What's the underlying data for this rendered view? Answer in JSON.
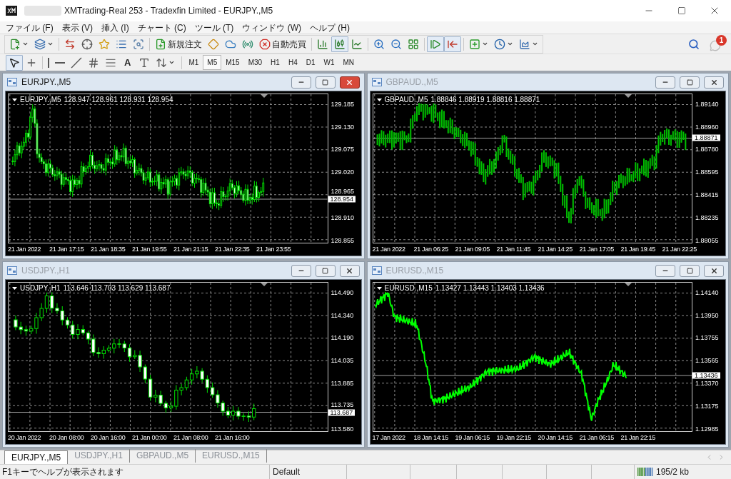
{
  "window": {
    "title": "XMTrading-Real 253 - Tradexfin Limited - EURJPY.,M5"
  },
  "menu": [
    "ファイル (F)",
    "表示 (V)",
    "挿入 (I)",
    "チャート (C)",
    "ツール (T)",
    "ウィンドウ (W)",
    "ヘルプ (H)"
  ],
  "toolbar": [
    {
      "kind": "button",
      "dropdown": true,
      "pressed": false
    },
    {
      "kind": "button",
      "dropdown": true,
      "pressed": false
    },
    {
      "kind": "separator"
    },
    {
      "kind": "button",
      "pressed": false
    },
    {
      "kind": "button",
      "pressed": false
    },
    {
      "kind": "button",
      "pressed": false
    },
    {
      "kind": "button",
      "pressed": false
    },
    {
      "kind": "button",
      "pressed": false
    },
    {
      "kind": "separator"
    },
    {
      "kind": "button",
      "label": "新規注文",
      "pressed": false
    },
    {
      "kind": "button",
      "pressed": false
    },
    {
      "kind": "button",
      "pressed": false
    },
    {
      "kind": "button",
      "pressed": false
    },
    {
      "kind": "button",
      "label": "自動売買",
      "pressed": false
    },
    {
      "kind": "separator"
    },
    {
      "kind": "button",
      "pressed": false
    },
    {
      "kind": "button",
      "pressed": true
    },
    {
      "kind": "button",
      "pressed": false
    },
    {
      "kind": "separator"
    },
    {
      "kind": "button",
      "pressed": false
    },
    {
      "kind": "button",
      "pressed": false
    },
    {
      "kind": "button",
      "pressed": false
    },
    {
      "kind": "separator"
    },
    {
      "kind": "button",
      "pressed": true
    },
    {
      "kind": "button",
      "pressed": true
    },
    {
      "kind": "separator"
    },
    {
      "kind": "button",
      "dropdown": true,
      "pressed": false
    },
    {
      "kind": "button",
      "dropdown": true,
      "pressed": false
    },
    {
      "kind": "button",
      "dropdown": true,
      "pressed": false
    }
  ],
  "notifications": {
    "badge": "1"
  },
  "drawing_tools": [
    {
      "kind": "button",
      "pressed": true
    },
    {
      "kind": "button",
      "pressed": false
    },
    {
      "kind": "separator"
    },
    {
      "kind": "button",
      "pressed": false
    },
    {
      "kind": "button",
      "pressed": false
    },
    {
      "kind": "button",
      "pressed": false
    },
    {
      "kind": "button",
      "pressed": false
    },
    {
      "kind": "button",
      "pressed": false
    },
    {
      "kind": "button",
      "label": "A",
      "pressed": false
    },
    {
      "kind": "button",
      "pressed": false
    },
    {
      "kind": "button",
      "dropdown": true,
      "pressed": false
    }
  ],
  "timeframes": [
    {
      "label": "M1",
      "selected": false
    },
    {
      "label": "M5",
      "selected": true
    },
    {
      "label": "M15",
      "selected": false
    },
    {
      "label": "M30",
      "selected": false
    },
    {
      "label": "H1",
      "selected": false
    },
    {
      "label": "H4",
      "selected": false
    },
    {
      "label": "D1",
      "selected": false
    },
    {
      "label": "W1",
      "selected": false
    },
    {
      "label": "MN",
      "selected": false
    }
  ],
  "charts": [
    {
      "title": "EURJPY.,M5",
      "active": true,
      "kind": "candles",
      "symbol": "EURJPY.,M5",
      "ohlc": "128.947 128.961 128.931 128.954",
      "price": "128.954",
      "price_ticks": [
        "129.185",
        "129.130",
        "129.075",
        "129.020",
        "128.965",
        "128.910",
        "128.855"
      ],
      "time_ticks": [
        "21 Jan 2022",
        "21 Jan 17:15",
        "21 Jan 18:35",
        "21 Jan 19:55",
        "21 Jan 21:15",
        "21 Jan 22:35",
        "21 Jan 23:55"
      ]
    },
    {
      "title": "GBPAUD.,M5",
      "active": false,
      "kind": "bars",
      "symbol": "GBPAUD.,M5",
      "ohlc": "1.88846 1.88919 1.88816 1.88871",
      "price": "1.88871",
      "price_ticks": [
        "1.89140",
        "1.88960",
        "1.88780",
        "1.88595",
        "1.88415",
        "1.88235",
        "1.88055"
      ],
      "time_ticks": [
        "21 Jan 2022",
        "21 Jan 06:25",
        "21 Jan 09:05",
        "21 Jan 11:45",
        "21 Jan 14:25",
        "21 Jan 17:05",
        "21 Jan 19:45",
        "21 Jan 22:25"
      ]
    },
    {
      "title": "USDJPY.,H1",
      "active": false,
      "kind": "candles",
      "symbol": "USDJPY.,H1",
      "ohlc": "113.646 113.703 113.629 113.687",
      "price": "113.687",
      "price_ticks": [
        "114.490",
        "114.340",
        "114.190",
        "114.035",
        "113.885",
        "113.735",
        "113.580"
      ],
      "time_ticks": [
        "20 Jan 2022",
        "20 Jan 08:00",
        "20 Jan 16:00",
        "21 Jan 00:00",
        "21 Jan 08:00",
        "21 Jan 16:00"
      ]
    },
    {
      "title": "EURUSD.,M15",
      "active": false,
      "kind": "line",
      "symbol": "EURUSD.,M15",
      "ohlc": "1.13427 1.13443 1.13403 1.13436",
      "price": "1.13436",
      "price_ticks": [
        "1.14140",
        "1.13950",
        "1.13755",
        "1.13565",
        "1.13370",
        "1.13175",
        "1.12985"
      ],
      "time_ticks": [
        "17 Jan 2022",
        "18 Jan 14:15",
        "19 Jan 06:15",
        "19 Jan 22:15",
        "20 Jan 14:15",
        "21 Jan 06:15",
        "21 Jan 22:15"
      ]
    }
  ],
  "tabs": [
    {
      "label": "EURJPY.,M5",
      "selected": true
    },
    {
      "label": "USDJPY.,H1",
      "selected": false
    },
    {
      "label": "GBPAUD.,M5",
      "selected": false
    },
    {
      "label": "EURUSD.,M15",
      "selected": false
    }
  ],
  "status_bar": {
    "help": "F1キーでヘルプが表示されます",
    "profile": "Default",
    "connection": "195/2 kb"
  }
}
